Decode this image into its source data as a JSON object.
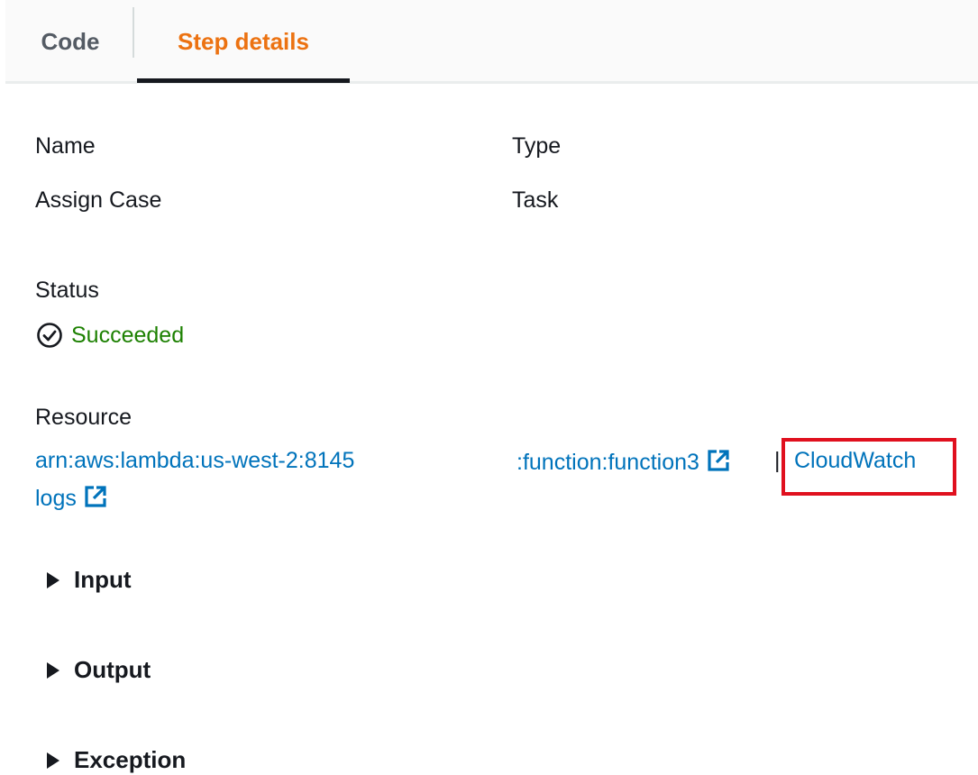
{
  "tabs": [
    {
      "label": "Code",
      "active": false
    },
    {
      "label": "Step details",
      "active": true
    }
  ],
  "details": {
    "name_label": "Name",
    "name_value": "Assign Case",
    "type_label": "Type",
    "type_value": "Task",
    "status_label": "Status",
    "status_value": "Succeeded",
    "resource_label": "Resource",
    "resource_arn_start": "arn:aws:lambda:us-west-2:8145",
    "resource_arn_end": ":function:function3",
    "separator": "|",
    "cloudwatch_part1": "CloudWatch",
    "cloudwatch_part2": "logs"
  },
  "sections": [
    {
      "label": "Input",
      "expanded": false
    },
    {
      "label": "Output",
      "expanded": false
    },
    {
      "label": "Exception",
      "expanded": false
    }
  ],
  "colors": {
    "active_tab": "#ec7211",
    "link": "#0073bb",
    "success": "#1d8102",
    "highlight": "#e0101e"
  },
  "icons": {
    "status": "check-circle-icon",
    "external": "external-link-icon",
    "expander": "caret-right-icon"
  }
}
